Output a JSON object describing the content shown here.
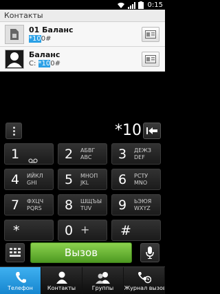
{
  "status_bar": {
    "time": "0:15"
  },
  "contacts_section": {
    "header": "Контакты",
    "items": [
      {
        "name": "01 Баланс",
        "number_highlight": "*10",
        "number_rest": "0#"
      },
      {
        "name": "Баланс",
        "number_prefix": "С: ",
        "number_highlight": "*10",
        "number_rest": "0#"
      }
    ]
  },
  "dialer": {
    "display": "*10",
    "call_label": "Вызов"
  },
  "keypad": [
    {
      "digit": "1",
      "letters": ""
    },
    {
      "digit": "2",
      "letters": "АБВГ ABC"
    },
    {
      "digit": "3",
      "letters": "ДЕЖЗ DEF"
    },
    {
      "digit": "4",
      "letters": "ИЙКЛ GHI"
    },
    {
      "digit": "5",
      "letters": "МНОП JKL"
    },
    {
      "digit": "6",
      "letters": "РСТУ MNO"
    },
    {
      "digit": "7",
      "letters": "ФХЦЧ PQRS"
    },
    {
      "digit": "8",
      "letters": "ШЩЪЫ TUV"
    },
    {
      "digit": "9",
      "letters": "ЬЭЮЯ WXYZ"
    },
    {
      "digit": "*",
      "letters": ""
    },
    {
      "digit": "0",
      "letters": "+"
    },
    {
      "digit": "#",
      "letters": ""
    }
  ],
  "tabs": [
    {
      "label": "Телефон",
      "icon": "phone-icon",
      "active": true
    },
    {
      "label": "Контакты",
      "icon": "person-icon",
      "active": false
    },
    {
      "label": "Группы",
      "icon": "group-icon",
      "active": false
    },
    {
      "label": "Журнал вызов",
      "icon": "call-history-icon",
      "active": false
    }
  ],
  "colors": {
    "call_green": "#6cbf36",
    "accent_blue": "#2aa0e6"
  }
}
